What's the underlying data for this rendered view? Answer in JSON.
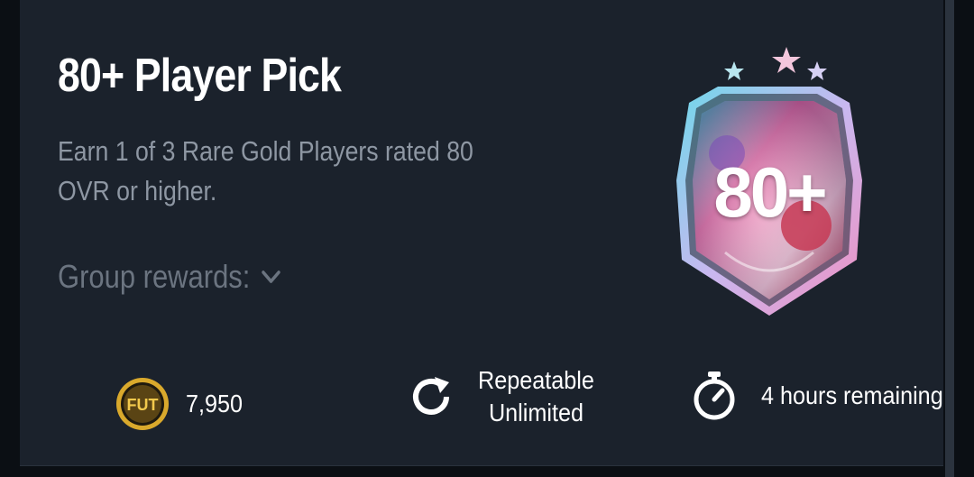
{
  "objective": {
    "title": "80+ Player Pick",
    "description": "Earn 1 of 3 Rare Gold Players rated 80 OVR or higher.",
    "group_rewards_label": "Group rewards:",
    "badge_label": "80+"
  },
  "footer": {
    "cost_value": "7,950",
    "coin_label": "FUT",
    "repeat_line1": "Repeatable",
    "repeat_line2": "Unlimited",
    "time_remaining": "4 hours remaining"
  },
  "colors": {
    "card_bg": "#1b222c",
    "page_bg": "#0b0f14",
    "muted_text": "#8e97a3",
    "coin_gold": "#d9a92c"
  }
}
